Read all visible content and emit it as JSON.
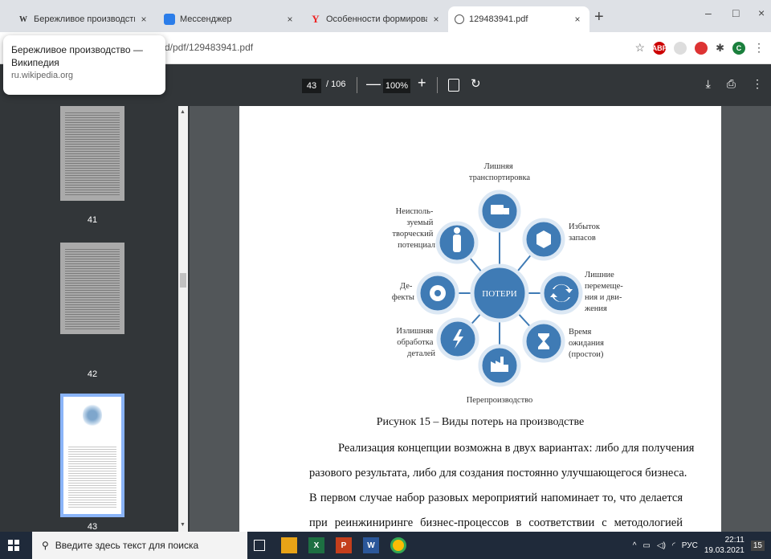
{
  "tabs": [
    {
      "title": "Бережливое производство — В",
      "favicon": "W",
      "close": "×"
    },
    {
      "title": "Мессенджер",
      "favicon": "",
      "close": "×"
    },
    {
      "title": "Особенности формирования с",
      "favicon": "Y",
      "close": "×"
    },
    {
      "title": "129483941.pdf",
      "favicon": "",
      "close": "×"
    }
  ],
  "new_tab": "+",
  "window_controls": {
    "minimize": "–",
    "maximize": "□",
    "close": "×"
  },
  "url": "d/pdf/129483941.pdf",
  "tooltip": {
    "title": "Бережливое производство — Википедия",
    "domain": "ru.wikipedia.org"
  },
  "pdf_toolbar": {
    "current_page": "43",
    "total_pages": "/ 106",
    "zoom": "100%",
    "zoom_minus": "—",
    "zoom_plus": "+"
  },
  "thumbnails": [
    {
      "number": "41"
    },
    {
      "number": "42"
    },
    {
      "number": "43"
    }
  ],
  "diagram": {
    "center": "ПОТЕРИ",
    "top_label": [
      "Лишняя",
      "транспортировка"
    ],
    "top_right_label": [
      "Избыток",
      "запасов"
    ],
    "right_label": [
      "Лишние",
      "перемеще-",
      "ния и дви-",
      "жения"
    ],
    "bottom_right_label": [
      "Время",
      "ожидания",
      "(простои)"
    ],
    "bottom_label": [
      "Перепроизводство"
    ],
    "bottom_left_label": [
      "Излишняя",
      "обработка",
      "деталей"
    ],
    "left_label": [
      "Де-",
      "фекты"
    ],
    "top_left_label": [
      "Неисполь-",
      "зуемый",
      "творческий",
      "потенциал"
    ]
  },
  "caption": "Рисунок 15 – Виды потерь на производстве",
  "paragraph_lines": [
    "Реализация концепции возможна в двух вариантах: либо для получения",
    "разового результата, либо для создания постоянно улучшающегося бизнеса.",
    "В первом случае набор разовых мероприятий напоминает то, что делается",
    "при реинжиниринге бизнес-процессов в соответствии с методологией"
  ],
  "taskbar": {
    "search_placeholder": "Введите здесь текст для поиска",
    "language": "РУС",
    "time": "22:11",
    "date": "19.03.2021",
    "notification_count": "15"
  },
  "colors": {
    "diagram_blue": "#3f7bb5",
    "diagram_light": "#dce8f4",
    "accent": "#8ab4f8"
  }
}
